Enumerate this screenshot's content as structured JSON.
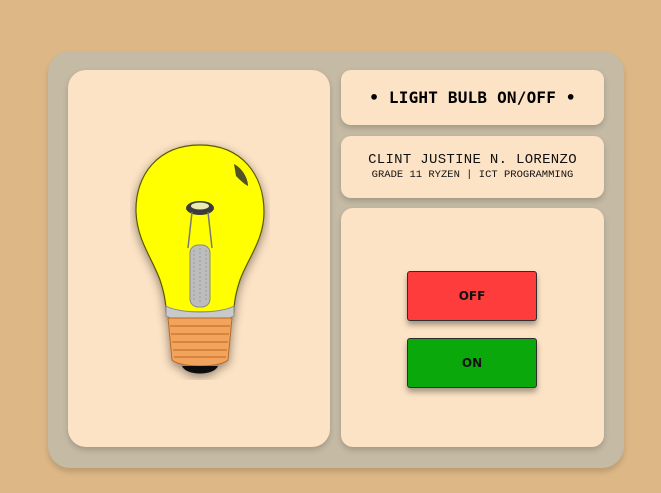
{
  "title": "• LIGHT BULB ON/OFF •",
  "author": {
    "name": "CLINT JUSTINE N. LORENZO",
    "subtitle": "GRADE 11 RYZEN | ICT PROGRAMMING"
  },
  "controls": {
    "off_label": "OFF",
    "on_label": "ON"
  },
  "bulb": {
    "state": "on",
    "icon": "light-bulb-icon"
  },
  "colors": {
    "background": "#ddb786",
    "frame": "#c5baa4",
    "card": "#fde3c5",
    "off_button": "#ff3c3c",
    "on_button": "#0aa80a",
    "bulb_glass": "#ffff00",
    "bulb_base": "#f2a35c"
  }
}
